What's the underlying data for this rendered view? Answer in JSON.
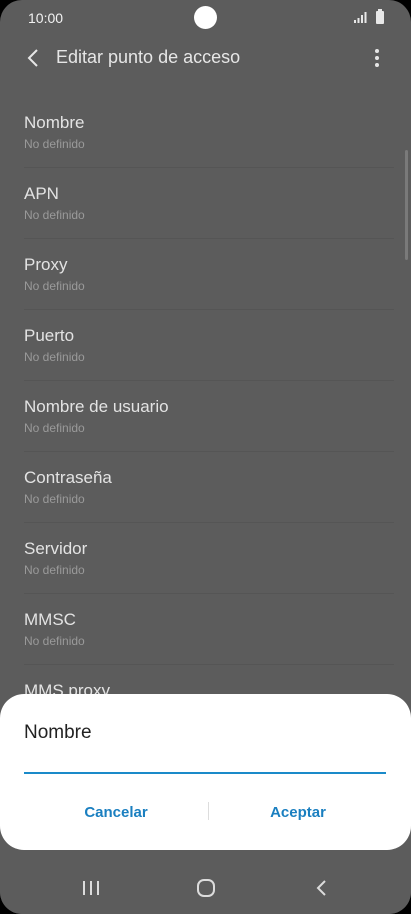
{
  "status_bar": {
    "time": "10:00"
  },
  "app_bar": {
    "title": "Editar punto de acceso"
  },
  "list_items": [
    {
      "label": "Nombre",
      "value": "No definido"
    },
    {
      "label": "APN",
      "value": "No definido"
    },
    {
      "label": "Proxy",
      "value": "No definido"
    },
    {
      "label": "Puerto",
      "value": "No definido"
    },
    {
      "label": "Nombre de usuario",
      "value": "No definido"
    },
    {
      "label": "Contraseña",
      "value": "No definido"
    },
    {
      "label": "Servidor",
      "value": "No definido"
    },
    {
      "label": "MMSC",
      "value": "No definido"
    },
    {
      "label": "MMS proxy",
      "value": ""
    }
  ],
  "dialog": {
    "title": "Nombre",
    "input_value": "",
    "cancel_label": "Cancelar",
    "ok_label": "Aceptar"
  },
  "colors": {
    "accent": "#1a8ac9",
    "scrim": "#5c5c5c",
    "dialog_bg": "#ffffff"
  },
  "icons": [
    "back-arrow-icon",
    "more-vert-icon",
    "signal-icon",
    "battery-icon",
    "recents-icon",
    "home-icon",
    "nav-back-icon"
  ]
}
